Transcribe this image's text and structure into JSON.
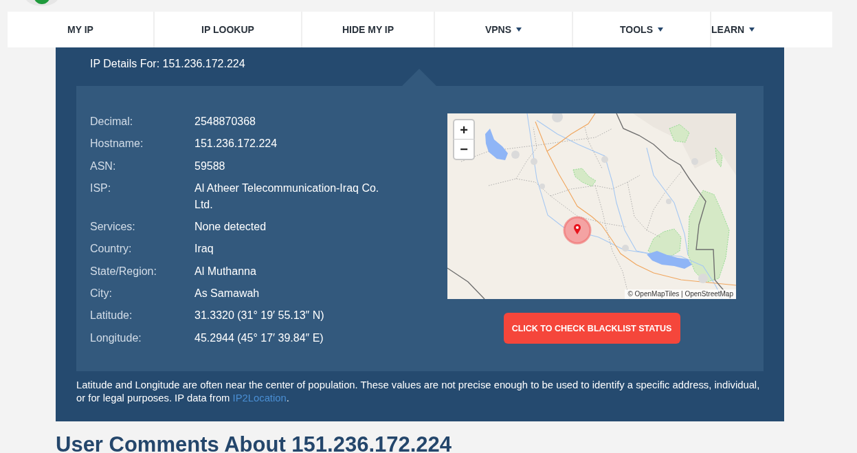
{
  "nav": [
    {
      "label": "MY IP",
      "dropdown": false
    },
    {
      "label": "IP LOOKUP",
      "dropdown": false
    },
    {
      "label": "HIDE MY IP",
      "dropdown": false
    },
    {
      "label": "VPNS",
      "dropdown": true
    },
    {
      "label": "TOOLS",
      "dropdown": true
    },
    {
      "label": "LEARN",
      "dropdown": true
    }
  ],
  "ip_details": {
    "title": "IP Details For: 151.236.172.224",
    "rows": [
      {
        "label": "Decimal:",
        "value": "2548870368"
      },
      {
        "label": "Hostname:",
        "value": "151.236.172.224"
      },
      {
        "label": "ASN:",
        "value": "59588"
      },
      {
        "label": "ISP:",
        "value": "Al Atheer Telecommunication-Iraq Co. Ltd."
      },
      {
        "label": "Services:",
        "value": "None detected"
      },
      {
        "label": "Country:",
        "value": "Iraq"
      },
      {
        "label": "State/Region:",
        "value": "Al Muthanna"
      },
      {
        "label": "City:",
        "value": "As Samawah"
      },
      {
        "label": "Latitude:",
        "value": "31.3320 (31° 19′ 55.13″ N)"
      },
      {
        "label": "Longitude:",
        "value": "45.2944 (45° 17′ 39.84″ E)"
      }
    ],
    "map": {
      "zoom_in": "+",
      "zoom_out": "−",
      "attribution": "© OpenMapTiles | OpenStreetMap"
    },
    "blacklist_button": "CLICK TO CHECK BLACKLIST STATUS",
    "note": {
      "text": "Latitude and Longitude are often near the center of population. These values are not precise enough to be used to identify a specific address, individual, or for legal purposes. IP data from ",
      "link": "IP2Location",
      "end": "."
    }
  },
  "comments_heading": "User Comments About 151.236.172.224"
}
